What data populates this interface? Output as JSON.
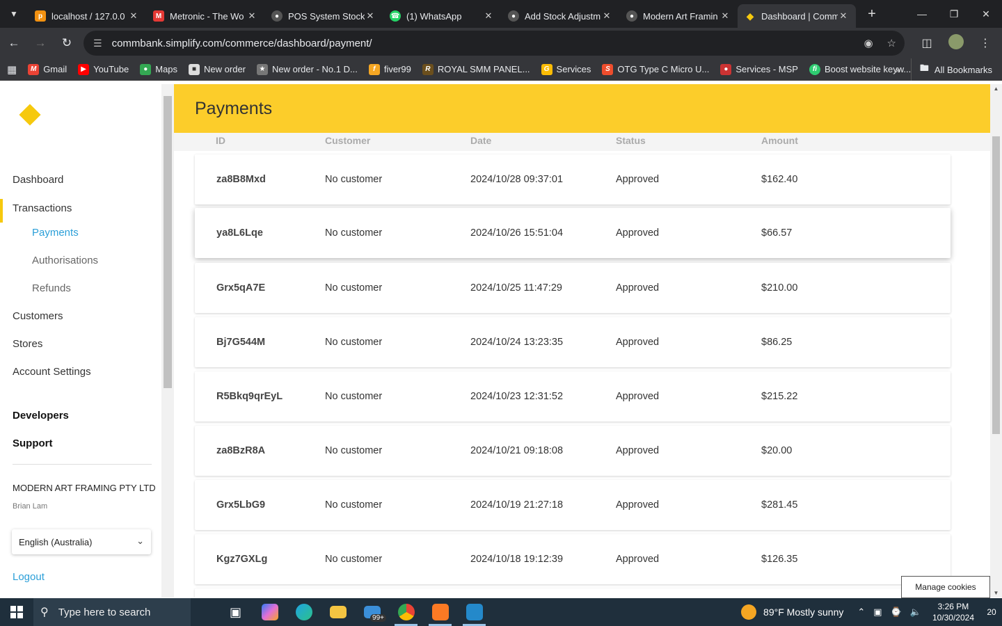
{
  "browser": {
    "tabs": [
      {
        "title": "localhost / 127.0.0",
        "icon": "phpmyadmin-icon",
        "color": "#f29111"
      },
      {
        "title": "Metronic - The Wo",
        "icon": "metronic-icon",
        "color": "#e53935"
      },
      {
        "title": "POS System Stock",
        "icon": "globe-icon",
        "color": "#888888"
      },
      {
        "title": "(1) WhatsApp",
        "icon": "whatsapp-icon",
        "color": "#25d366"
      },
      {
        "title": "Add Stock Adjustm",
        "icon": "globe-icon",
        "color": "#888888"
      },
      {
        "title": "Modern Art Framin",
        "icon": "globe-icon",
        "color": "#888888"
      },
      {
        "title": "Dashboard | Comm",
        "icon": "commbank-icon",
        "color": "#f6c90e"
      }
    ],
    "url": "commbank.simplify.com/commerce/dashboard/payment/",
    "bookmarks": [
      {
        "label": "Gmail",
        "color": "#ea4335"
      },
      {
        "label": "YouTube",
        "color": "#ff0000"
      },
      {
        "label": "Maps",
        "color": "#34a853"
      },
      {
        "label": "New order",
        "color": "#dddddd"
      },
      {
        "label": "New order - No.1 D...",
        "color": "#777777"
      },
      {
        "label": "fiver99",
        "color": "#f5a623"
      },
      {
        "label": "ROYAL SMM PANEL...",
        "color": "#6b4f1d"
      },
      {
        "label": "Services",
        "color": "#fbbc05"
      },
      {
        "label": "OTG Type C Micro U...",
        "color": "#ee4d2d"
      },
      {
        "label": "Services - MSP",
        "color": "#cc3333"
      },
      {
        "label": "Boost website keyw...",
        "color": "#2ecc71"
      }
    ],
    "all_bookmarks": "All Bookmarks"
  },
  "sidebar": {
    "items": {
      "dashboard": "Dashboard",
      "transactions": "Transactions",
      "payments": "Payments",
      "authorisations": "Authorisations",
      "refunds": "Refunds",
      "customers": "Customers",
      "stores": "Stores",
      "account_settings": "Account Settings",
      "developers": "Developers",
      "support": "Support"
    },
    "company": "MODERN ART FRAMING PTY LTD",
    "user": "Brian Lam",
    "language": "English (Australia)",
    "logout": "Logout"
  },
  "main": {
    "title": "Payments",
    "columns": {
      "id": "ID",
      "customer": "Customer",
      "date": "Date",
      "status": "Status",
      "amount": "Amount"
    },
    "rows": [
      {
        "id": "za8B8Mxd",
        "customer": "No customer",
        "date": "2024/10/28 09:37:01",
        "status": "Approved",
        "amount": "$162.40"
      },
      {
        "id": "ya8L6Lqe",
        "customer": "No customer",
        "date": "2024/10/26 15:51:04",
        "status": "Approved",
        "amount": "$66.57"
      },
      {
        "id": "Grx5qA7E",
        "customer": "No customer",
        "date": "2024/10/25 11:47:29",
        "status": "Approved",
        "amount": "$210.00"
      },
      {
        "id": "Bj7G544M",
        "customer": "No customer",
        "date": "2024/10/24 13:23:35",
        "status": "Approved",
        "amount": "$86.25"
      },
      {
        "id": "R5Bkq9qrEyL",
        "customer": "No customer",
        "date": "2024/10/23 12:31:52",
        "status": "Approved",
        "amount": "$215.22"
      },
      {
        "id": "za8BzR8A",
        "customer": "No customer",
        "date": "2024/10/21 09:18:08",
        "status": "Approved",
        "amount": "$20.00"
      },
      {
        "id": "Grx5LbG9",
        "customer": "No customer",
        "date": "2024/10/19 21:27:18",
        "status": "Approved",
        "amount": "$281.45"
      },
      {
        "id": "Kgz7GXLg",
        "customer": "No customer",
        "date": "2024/10/18 19:12:39",
        "status": "Approved",
        "amount": "$126.35"
      }
    ]
  },
  "cookies_button": "Manage cookies",
  "taskbar": {
    "search_placeholder": "Type here to search",
    "mail_badge": "99+",
    "weather": "89°F  Mostly sunny",
    "time": "3:26 PM",
    "date": "10/30/2024",
    "notifications": "20"
  }
}
